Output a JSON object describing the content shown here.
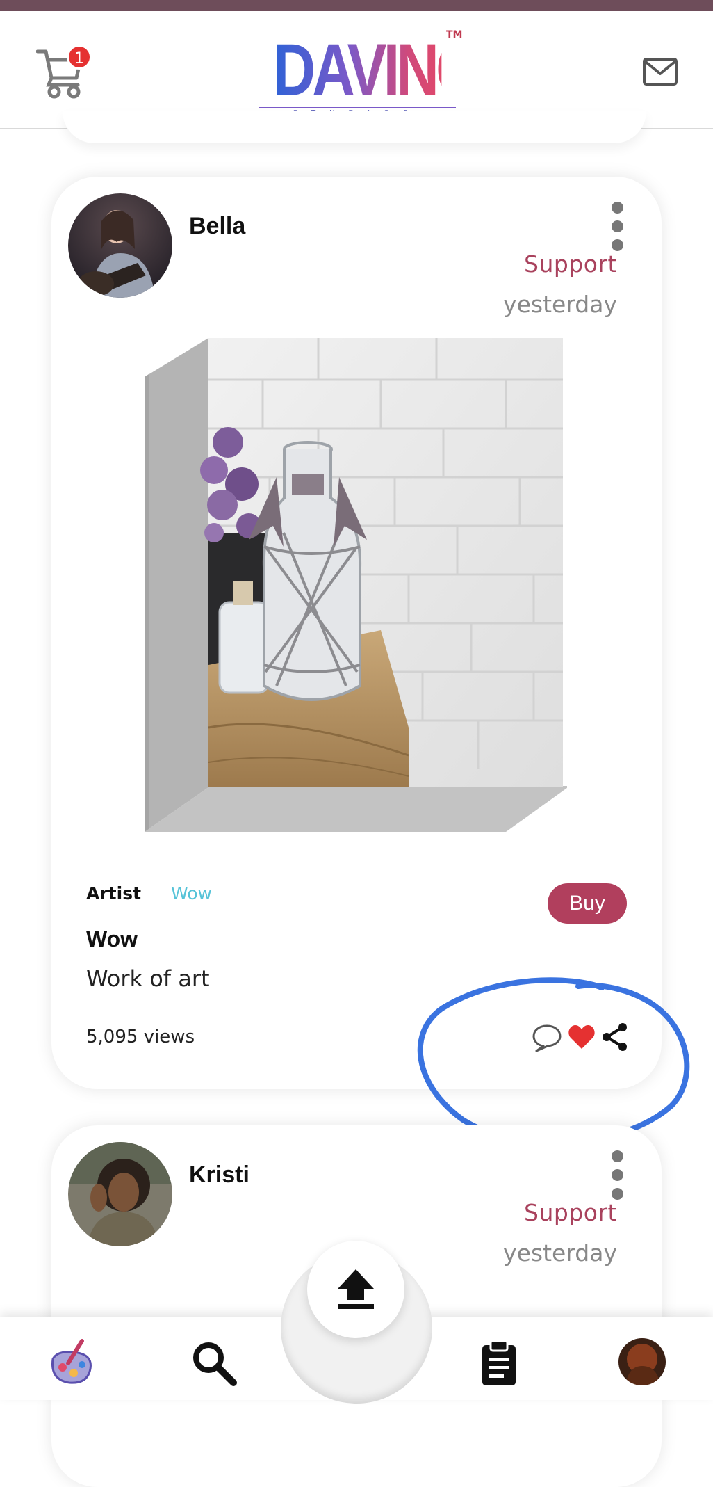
{
  "header": {
    "cart_badge": "1",
    "logo_text": "DAVINCII",
    "logo_sub": "STUDIOS",
    "logo_tm": "TM"
  },
  "posts": [
    {
      "username": "Bella",
      "support_label": "Support",
      "time": "yesterday",
      "artist_label": "Artist",
      "artist_name": "Wow",
      "buy_label": "Buy",
      "title": "Wow",
      "description": "Work of art",
      "views": "5,095 views"
    },
    {
      "username": "Kristi",
      "support_label": "Support",
      "time": "yesterday"
    }
  ],
  "colors": {
    "accent": "#b13f5d",
    "artist_link": "#56c3d8",
    "like": "#e53131",
    "annotation": "#3a73e0"
  },
  "icons": {
    "cart": "cart-icon",
    "mail": "mail-icon",
    "comment": "comment-icon",
    "like": "heart-icon",
    "share": "share-icon",
    "upload": "upload-icon",
    "nav_palette": "palette-icon",
    "nav_search": "search-icon",
    "nav_clipboard": "clipboard-icon"
  }
}
